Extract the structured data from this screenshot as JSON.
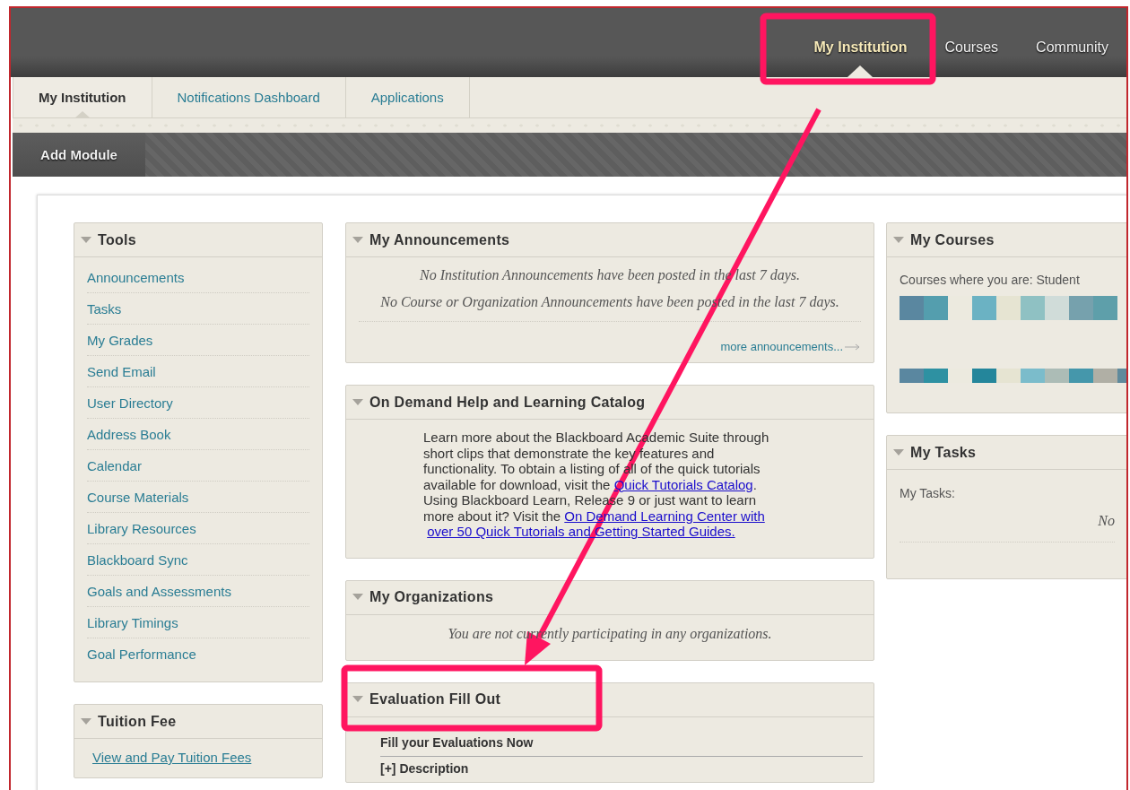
{
  "header": {
    "nav": [
      {
        "label": "My Institution",
        "selected": true
      },
      {
        "label": "Courses",
        "selected": false
      },
      {
        "label": "Community",
        "selected": false
      }
    ]
  },
  "tabs": [
    {
      "label": "My Institution",
      "selected": true
    },
    {
      "label": "Notifications Dashboard",
      "selected": false
    },
    {
      "label": "Applications",
      "selected": false
    }
  ],
  "toolbar": {
    "button": "Add Module"
  },
  "columns": [
    [
      {
        "kind": "links",
        "title": "Tools",
        "items": [
          "Announcements",
          "Tasks",
          "My Grades",
          "Send Email",
          "User Directory",
          "Address Book",
          "Calendar",
          "Course Materials",
          "Library Resources",
          "Blackboard Sync",
          "Goals and Assessments",
          "Library Timings",
          "Goal Performance"
        ]
      },
      {
        "kind": "link",
        "title": "Tuition Fee",
        "link": "View and Pay Tuition Fees"
      }
    ],
    [
      {
        "kind": "announcements",
        "title": "My Announcements",
        "messages": [
          "No Institution Announcements have been posted in the last 7 days.",
          "No Course or Organization Announcements have been posted in the last 7 days."
        ],
        "more": "more announcements..."
      },
      {
        "kind": "paragraph",
        "title": "On Demand Help and Learning Catalog",
        "segments": [
          {
            "text": "Learn more about the Blackboard Academic Suite through short clips that demonstrate the key features and functionality. To obtain a listing of all of the quick tutorials available for download, visit the ",
            "link": false
          },
          {
            "text": "Quick Tutorials Catalog",
            "link": true
          },
          {
            "text": ". Using Blackboard Learn, Release 9 or just want to learn more about it? Visit the ",
            "link": false
          },
          {
            "text": "On Demand Learning Center with",
            "link": true
          },
          {
            "text": "over 50 Quick Tutorials and Getting Started Guides.",
            "link": true
          }
        ]
      },
      {
        "kind": "message",
        "title": "My Organizations",
        "message": "You are not currently participating in any organizations."
      },
      {
        "kind": "evaluation",
        "title": "Evaluation Fill Out",
        "heading": "Fill your Evaluations Now",
        "toggle": "[+] Description"
      }
    ],
    [
      {
        "kind": "courses",
        "title": "My Courses",
        "label": "Courses where you are: Student"
      },
      {
        "kind": "tasks",
        "title": "My Tasks",
        "label": "My Tasks:",
        "message": "No"
      }
    ]
  ]
}
